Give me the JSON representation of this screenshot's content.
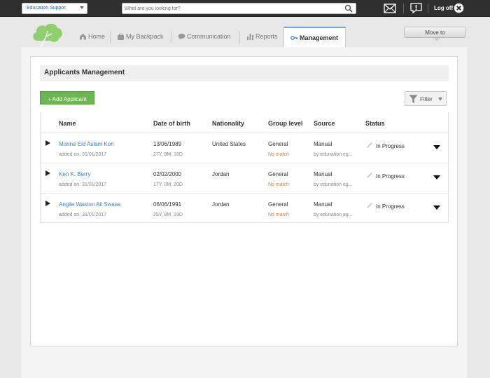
{
  "topbar": {
    "org_select": "Education Suppor",
    "search_placeholder": "What are you looking for?",
    "logoff_label": "Log off"
  },
  "nav": {
    "items": [
      {
        "label": "Home",
        "icon": "home-icon"
      },
      {
        "label": "My Backpack",
        "icon": "backpack-icon"
      },
      {
        "label": "Communication",
        "icon": "chat-icon"
      },
      {
        "label": "Reports",
        "icon": "bar-chart-icon"
      },
      {
        "label": "Management",
        "icon": "key-icon",
        "active": true
      }
    ],
    "move_to_label": "Move to"
  },
  "page": {
    "title": "Applicants Management",
    "add_button": "+ Add Applicant",
    "filter_label": "Filter"
  },
  "table": {
    "columns": [
      "Name",
      "Date of birth",
      "Nationality",
      "Group level",
      "Source",
      "Status"
    ],
    "rows": [
      {
        "name": "Monne Eid Aslam Kori",
        "added": "added on: 31/01/2017",
        "dob": "13/06/1989",
        "age": "27Y, 8M, 16D",
        "nationality": "United States",
        "group": "General",
        "match": "No match",
        "source": "Manual",
        "source_by": "by edunation eg...",
        "status": "In Progress"
      },
      {
        "name": "Ken K. Berry",
        "added": "added on: 31/01/2017",
        "dob": "02/02/2000",
        "age": "17Y, 0M, 20D",
        "nationality": "Jordan",
        "group": "General",
        "match": "No match",
        "source": "Manual",
        "source_by": "by edunation eg...",
        "status": "In Progress"
      },
      {
        "name": "Angile Waston Ali Swaas",
        "added": "added on: 31/01/2017",
        "dob": "06/06/1991",
        "age": "25Y, 8M, 23D",
        "nationality": "Jordan",
        "group": "General",
        "match": "No match",
        "source": "Manual",
        "source_by": "by edunation eg...",
        "status": "In Progress"
      }
    ]
  },
  "colors": {
    "accent_green": "#6cb552",
    "link_blue": "#3b82c4",
    "no_match_orange": "#c8874c",
    "topbar": "#2f2f2f"
  }
}
